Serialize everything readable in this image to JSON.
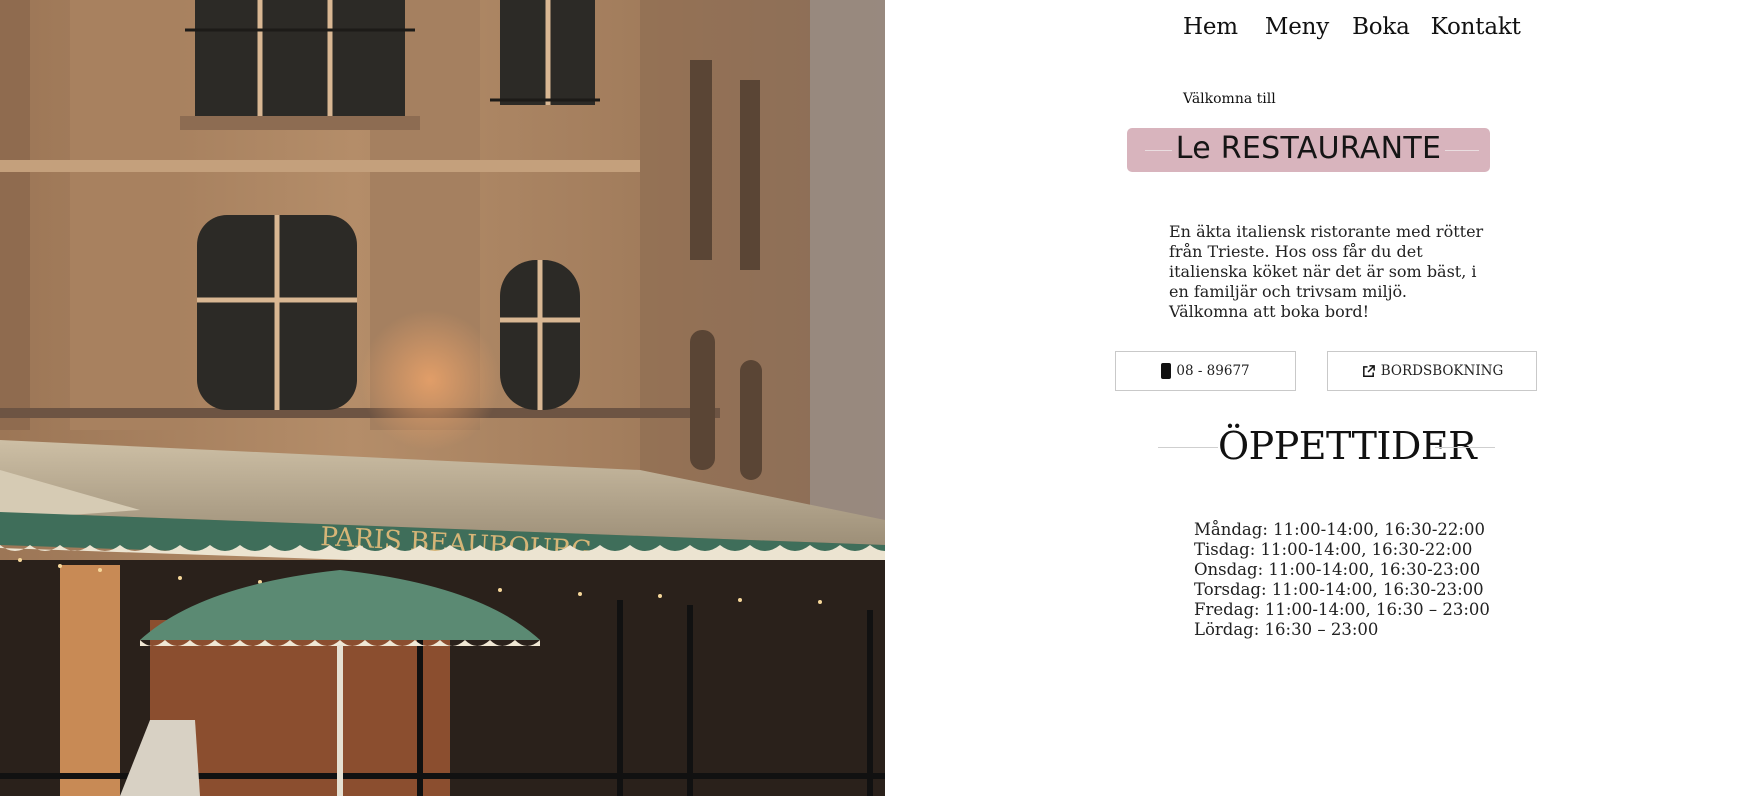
{
  "nav": {
    "items": [
      "Hem",
      "Meny",
      "Boka",
      "Kontakt"
    ]
  },
  "hero": {
    "awning_sign": "PARIS BEAUBOURG"
  },
  "welcome": "Välkomna till",
  "title": "Le RESTAURANTE",
  "intro": "En äkta italiensk ristorante med rötter från Trieste. Hos oss får du det italienska köket när det är som bäst, i en familjär och trivsam miljö. Välkomna att boka bord!",
  "buttons": {
    "phone_label": "08 - 89677",
    "phone_icon": "phone-icon",
    "booking_label": "BORDSBOKNING",
    "booking_icon": "external-link-icon"
  },
  "hours": {
    "heading": "ÖPPETTIDER",
    "lines": [
      "Måndag: 11:00-14:00, 16:30-22:00",
      "Tisdag: 11:00-14:00, 16:30-22:00",
      "Onsdag: 11:00-14:00, 16:30-23:00",
      "Torsdag: 11:00-14:00, 16:30-23:00",
      "Fredag: 11:00-14:00, 16:30 – 23:00",
      "Lördag: 16:30 – 23:00"
    ]
  },
  "colors": {
    "title_bg": "#d8b4bd",
    "awning_green": "#3f6e5a",
    "stone": "#b08a66"
  }
}
